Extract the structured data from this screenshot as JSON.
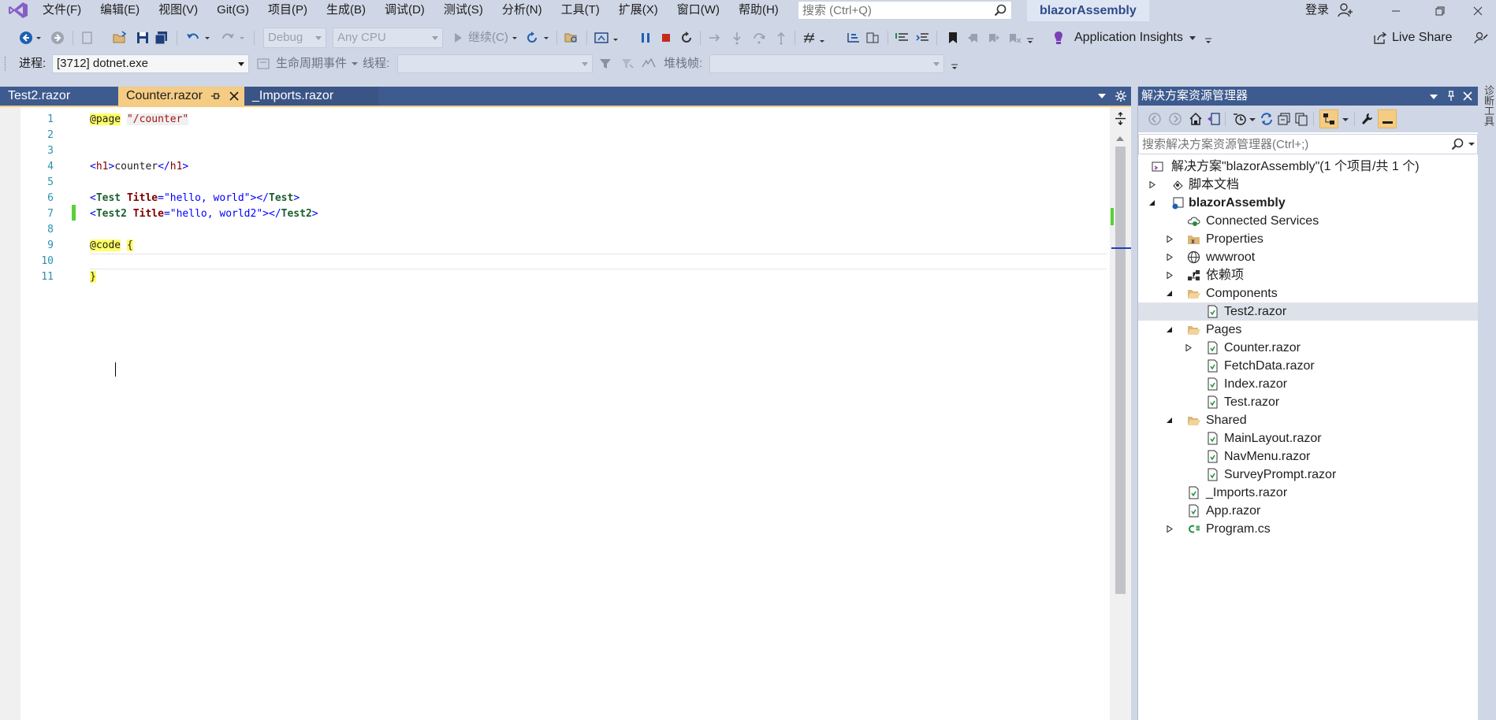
{
  "menu": [
    "文件(F)",
    "编辑(E)",
    "视图(V)",
    "Git(G)",
    "项目(P)",
    "生成(B)",
    "调试(D)",
    "测试(S)",
    "分析(N)",
    "工具(T)",
    "扩展(X)",
    "窗口(W)",
    "帮助(H)"
  ],
  "search": {
    "placeholder": "搜索 (Ctrl+Q)"
  },
  "solution_title": "blazorAssembly",
  "signin": "登录",
  "toolbar": {
    "config": "Debug",
    "platform": "Any CPU",
    "continue_label": "继续(C)",
    "app_insights": "Application Insights",
    "live_share": "Live Share"
  },
  "debug_toolbar": {
    "process_label": "进程:",
    "process_value": "[3712] dotnet.exe",
    "lifecycle_label": "生命周期事件",
    "thread_label": "线程:",
    "stackframe_label": "堆栈帧:"
  },
  "tabs": [
    {
      "label": "Test2.razor",
      "active": false
    },
    {
      "label": "Counter.razor",
      "active": true
    },
    {
      "label": "_Imports.razor",
      "active": false
    }
  ],
  "editor": {
    "line_numbers": [
      "1",
      "2",
      "3",
      "4",
      "5",
      "6",
      "7",
      "8",
      "9",
      "10",
      "11"
    ],
    "code": {
      "l1_directive": "@page",
      "l1_value": "\"/counter\"",
      "l4_open": "<",
      "l4_tag": "h1",
      "l4_close": ">",
      "l4_text": "counter",
      "l4_end_open": "</",
      "l4_end_tag": "h1",
      "l4_end_close": ">",
      "l6_open": "<",
      "l6_comp": "Test",
      "l6_attr": "Title",
      "l6_eq": "=",
      "l6_val": "\"hello, world\"",
      "l6_rest": "></",
      "l6_end": "Test",
      "l6_close": ">",
      "l7_open": "<",
      "l7_comp": "Test2",
      "l7_attr": "Title",
      "l7_eq": "=",
      "l7_val": "\"hello, world2\"",
      "l7_rest": "></",
      "l7_end": "Test2",
      "l7_close": ">",
      "l9_directive": "@code",
      "l9_brace": "{",
      "l11_brace": "}"
    }
  },
  "solution_explorer": {
    "title": "解决方案资源管理器",
    "search_placeholder": "搜索解决方案资源管理器(Ctrl+;)",
    "nodes": {
      "solution": "解决方案\"blazorAssembly\"(1 个项目/共 1 个)",
      "scripts": "脚本文档",
      "project": "blazorAssembly",
      "connected": "Connected Services",
      "properties": "Properties",
      "wwwroot": "wwwroot",
      "deps": "依赖项",
      "components": "Components",
      "test2": "Test2.razor",
      "pages": "Pages",
      "counter": "Counter.razor",
      "fetchdata": "FetchData.razor",
      "index": "Index.razor",
      "test": "Test.razor",
      "shared": "Shared",
      "mainlayout": "MainLayout.razor",
      "navmenu": "NavMenu.razor",
      "surveyprompt": "SurveyPrompt.razor",
      "imports": "_Imports.razor",
      "app": "App.razor",
      "program": "Program.cs"
    }
  },
  "side_strip": "诊断工具",
  "colors": {
    "chrome": "#cfd6e5",
    "tab_strip": "#3e5b8f",
    "active_tab": "#f5cc84",
    "line_number": "#2b91af",
    "change_marker": "#57d13a"
  }
}
